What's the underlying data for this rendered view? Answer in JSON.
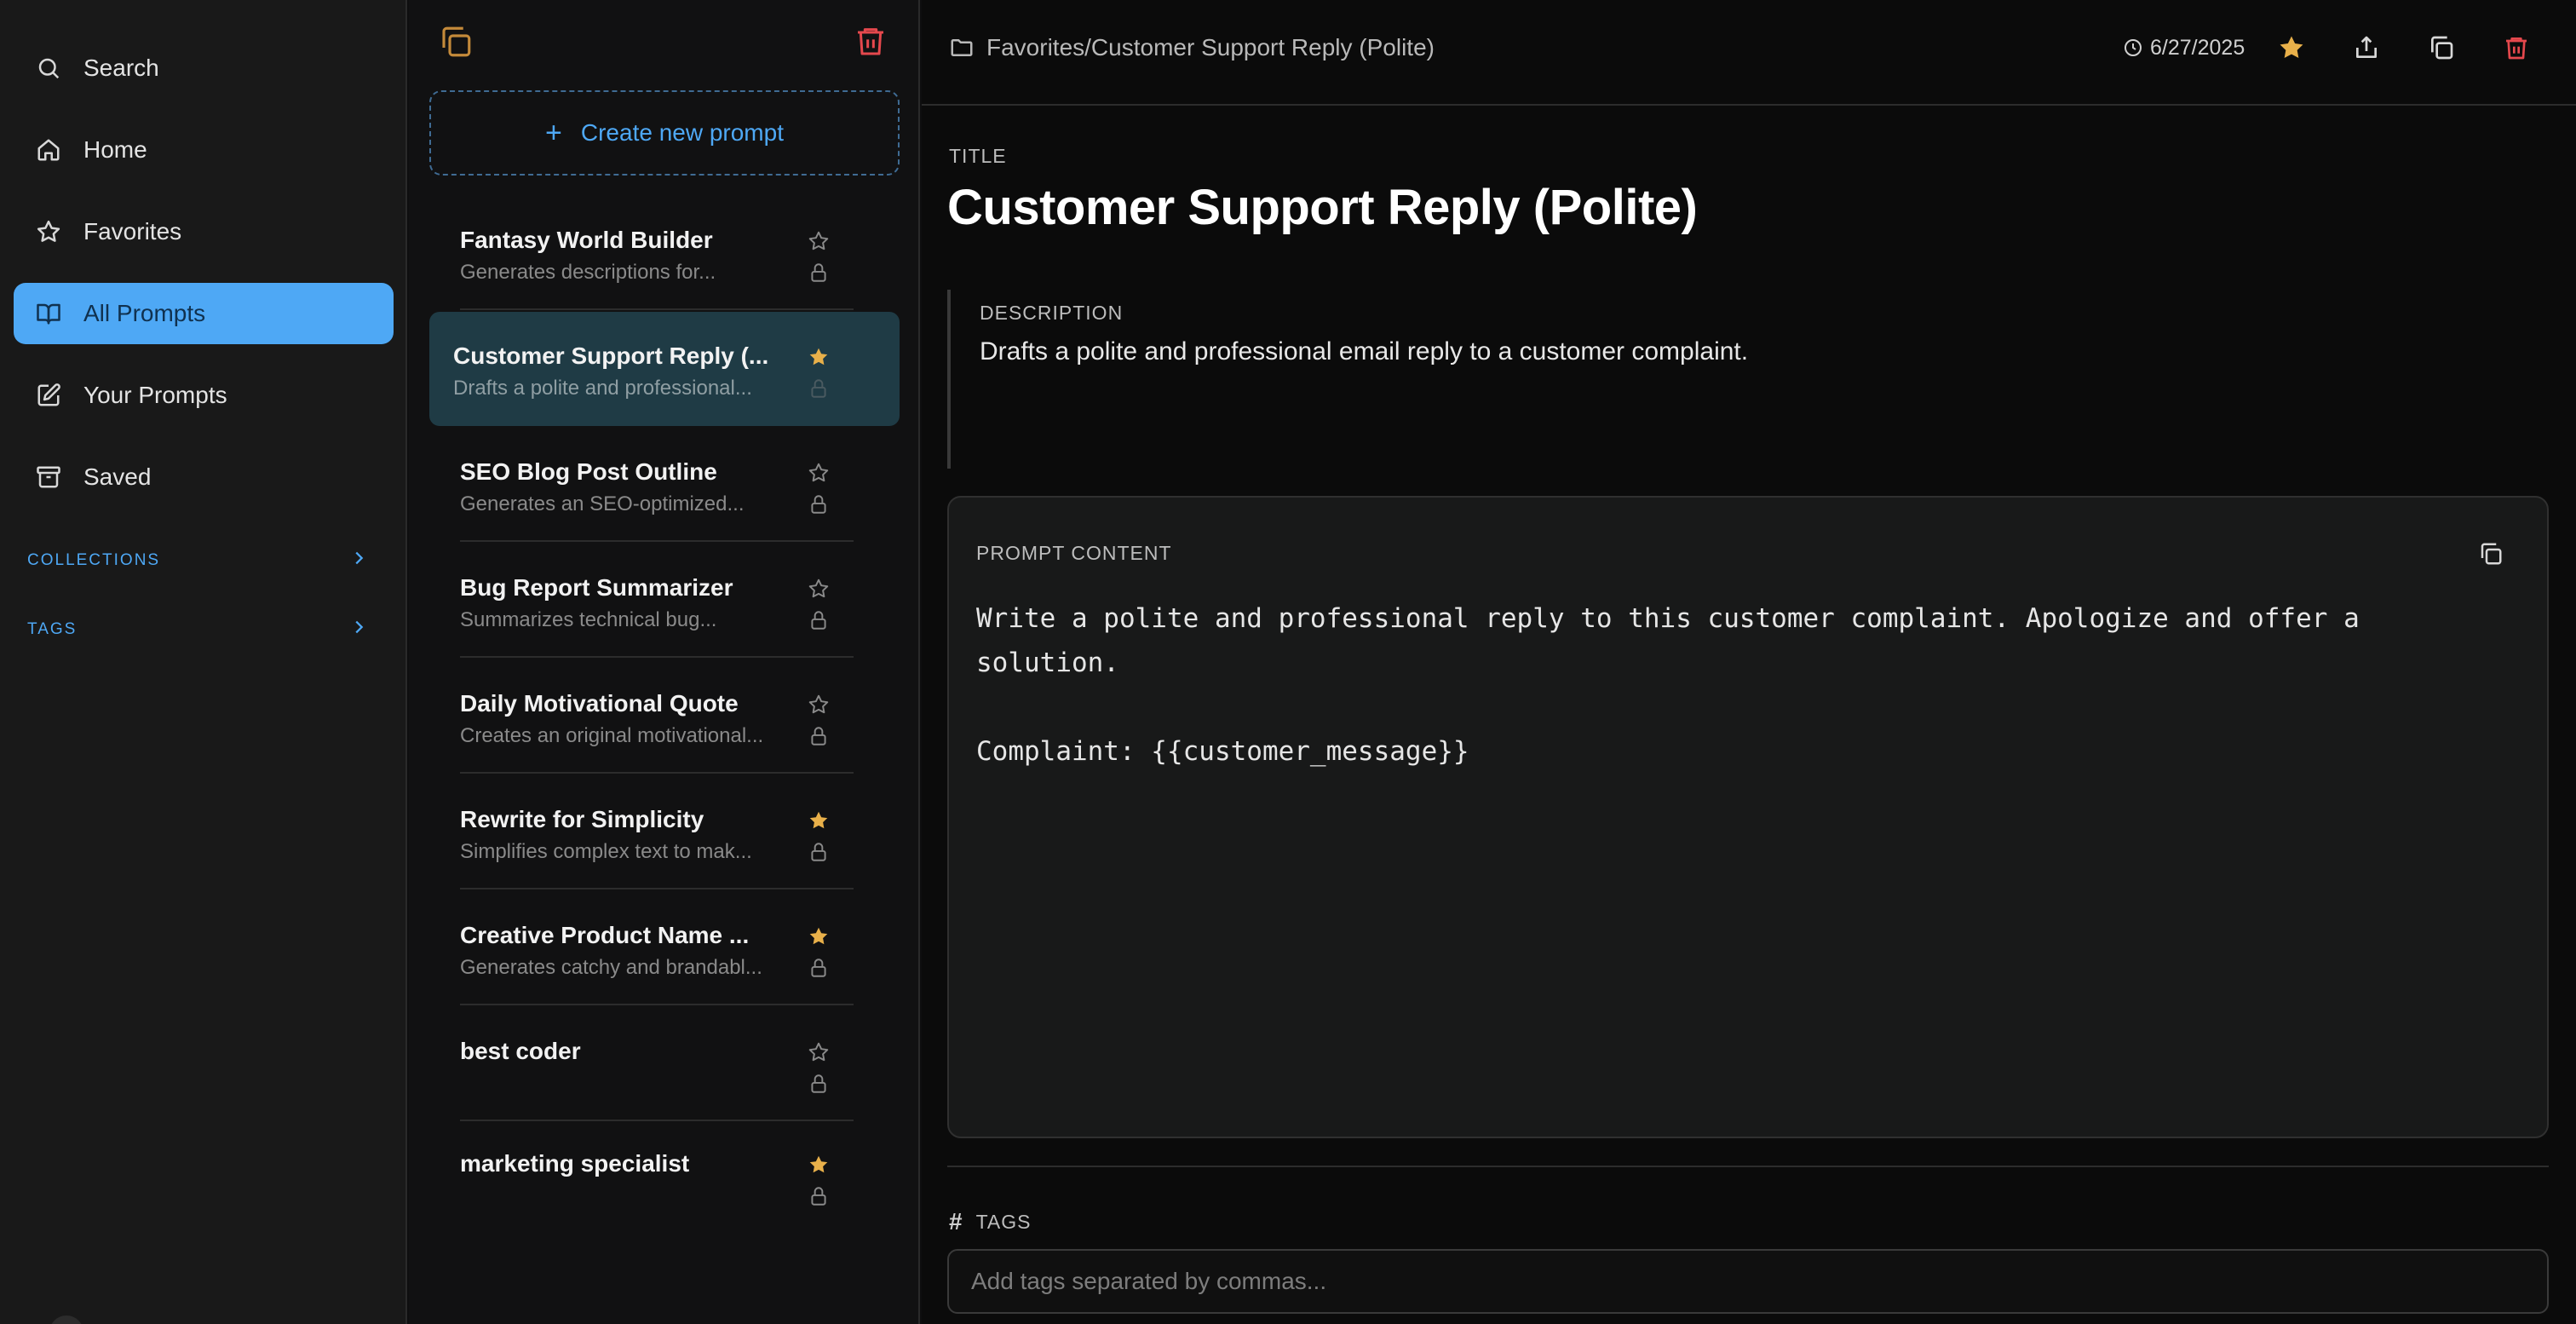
{
  "nav": {
    "items": [
      {
        "label": "Search",
        "icon": "search-icon"
      },
      {
        "label": "Home",
        "icon": "home-icon"
      },
      {
        "label": "Favorites",
        "icon": "star-icon"
      },
      {
        "label": "All Prompts",
        "icon": "book-open-icon",
        "active": true
      },
      {
        "label": "Your Prompts",
        "icon": "edit-icon"
      },
      {
        "label": "Saved",
        "icon": "archive-icon"
      }
    ],
    "sections": [
      {
        "label": "COLLECTIONS"
      },
      {
        "label": "TAGS"
      }
    ]
  },
  "list": {
    "create_label": "Create new prompt",
    "items": [
      {
        "title": "Fantasy World Builder",
        "desc": "Generates descriptions for...",
        "starred": false
      },
      {
        "title": "Customer Support Reply (...",
        "desc": "Drafts a polite and professional...",
        "starred": true,
        "selected": true
      },
      {
        "title": "SEO Blog Post Outline",
        "desc": "Generates an SEO-optimized...",
        "starred": false
      },
      {
        "title": "Bug Report Summarizer",
        "desc": "Summarizes technical bug...",
        "starred": false
      },
      {
        "title": "Daily Motivational Quote",
        "desc": "Creates an original motivational...",
        "starred": false
      },
      {
        "title": "Rewrite for Simplicity",
        "desc": "Simplifies complex text to mak...",
        "starred": true
      },
      {
        "title": "Creative Product Name ...",
        "desc": "Generates catchy and brandabl...",
        "starred": true
      },
      {
        "title": "best coder",
        "desc": "",
        "starred": false
      },
      {
        "title": "marketing specialist",
        "desc": "",
        "starred": true
      }
    ]
  },
  "main": {
    "breadcrumb": "Favorites/Customer Support Reply (Polite)",
    "date": "6/27/2025",
    "title_label": "TITLE",
    "title": "Customer Support Reply (Polite)",
    "description_label": "DESCRIPTION",
    "description": "Drafts a polite and professional email reply to a customer complaint.",
    "content_label": "PROMPT CONTENT",
    "content": "Write a polite and professional reply to this customer complaint. Apologize and offer a\nsolution.\n\nComplaint: {{customer_message}}",
    "tags_label": "TAGS",
    "tags_placeholder": "Add tags separated by commas...",
    "tags_value": ""
  },
  "colors": {
    "accent": "#4ea8f5",
    "star": "#e8b04a",
    "danger": "#e5484d",
    "selected_bg": "#1f3b45"
  }
}
